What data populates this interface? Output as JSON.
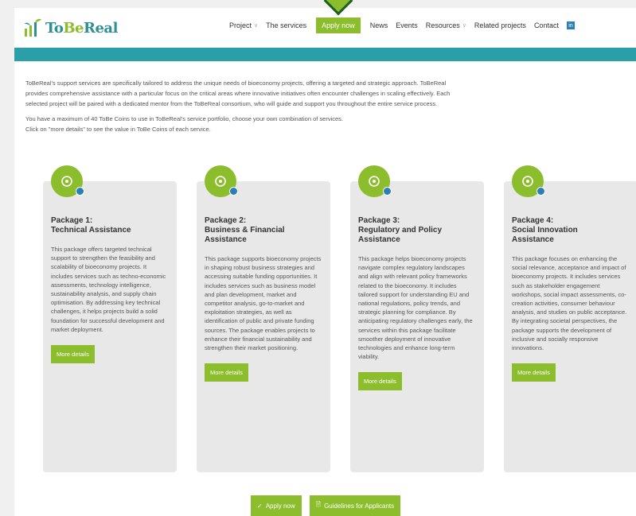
{
  "header": {
    "logo_text_a": "To",
    "logo_text_b": "Be",
    "logo_text_c": "Real",
    "nav": [
      {
        "label": "Project",
        "caret": true
      },
      {
        "label": "The services",
        "caret": false
      },
      {
        "label": "Apply now",
        "caret": false,
        "highlight": true
      },
      {
        "label": "News",
        "caret": false
      },
      {
        "label": "Events",
        "caret": false
      },
      {
        "label": "Resources",
        "caret": true
      },
      {
        "label": "Related projects",
        "caret": false
      },
      {
        "label": "Contact",
        "caret": false
      }
    ],
    "social_icon": "linkedin-icon"
  },
  "intro": {
    "line1": "ToBeReal's support services are specifically tailored to address the unique needs of bioeconomy projects, offering a targeted and strategic approach. ToBeReal",
    "line2": "provides comprehensive assistance with a particular focus on the critical areas where innovative initiatives often encounter challenges in scaling effectively. Each",
    "line3": "selected project will be paired with a dedicated mentor from the ToBeReal consortium, who will guide and support you throughout the entire service process.",
    "line4": "You have a maximum of 40 ToBe Coins to use in ToBeReal's service portfolio, choose your own combination of services.",
    "line5": "Click on \"more details\" to see the value in ToBe Coins of each service."
  },
  "packages": [
    {
      "title1": "Package 1:",
      "title2": "Technical Assistance",
      "title3": "",
      "desc": "This package offers targeted technical support to strengthen the feasibility and scalability of bioeconomy projects. It includes services such as techno-economic assessments, technology intelligence, sustainability analysis, and supply chain optimisation. By addressing key technical challenges, it helps projects build a solid foundation for successful development and market deployment.",
      "button": "More details",
      "icon": "gear-icon"
    },
    {
      "title1": "Package 2:",
      "title2": "Business & Financial",
      "title3": "Assistance",
      "desc": "This package supports bioeconomy projects in shaping robust business strategies and accessing suitable funding opportunities. It includes services such as business model and plan development, market and competitor analysis, go-to-market and exploitation strategies, as well as identification of public and private funding sources. The package enables projects to enhance their financial sustainability and strengthen their market positioning.",
      "button": "More details",
      "icon": "chart-icon"
    },
    {
      "title1": "Package 3:",
      "title2": "Regulatory and Policy",
      "title3": "Assistance",
      "desc": "This package helps bioeconomy projects navigate complex regulatory landscapes and align with relevant policy frameworks related to the bioeconomy. It includes tailored support for understanding EU and national regulations, policy trends, and strategic planning for compliance. By anticipating regulatory challenges early, the services within this package facilitate smoother deployment of innovative technologies and enhance long-term viability.",
      "button": "More details",
      "icon": "document-icon"
    },
    {
      "title1": "Package 4:",
      "title2": "Social Innovation",
      "title3": "Assistance",
      "desc": "This package focuses on enhancing the social relevance, acceptance and impact of bioeconomy projects. It includes services such as stakeholder engagement workshops, social impact assessments, co-creation activities, consumer behaviour analysis, and studies on public acceptance. By integrating societal perspectives, the package supports the development of inclusive and socially responsive innovations.",
      "button": "More details",
      "icon": "people-icon"
    }
  ],
  "bottom": {
    "apply": "Apply now",
    "guidelines": "Guidelines for Applicants"
  },
  "colors": {
    "green": "#8bbd2c",
    "teal": "#2a9fa8",
    "blue": "#2a7fb6"
  }
}
